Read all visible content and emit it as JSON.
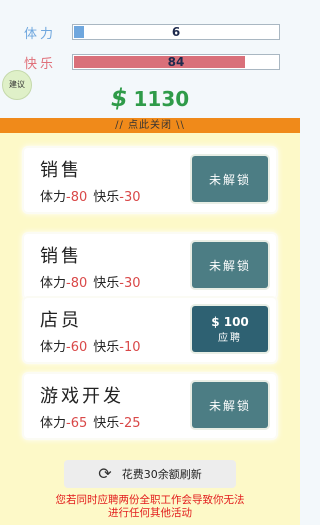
{
  "stats": {
    "stamina": {
      "label": "体力",
      "value": "6",
      "fraction": 0.06
    },
    "happiness": {
      "label": "快乐",
      "value": "84",
      "fraction": 0.84
    }
  },
  "advice_label": "建议",
  "money": {
    "symbol": "$",
    "amount": "1130"
  },
  "panel": {
    "close_label": "// 点此关闭 \\\\",
    "jobs": [
      {
        "title": "销售",
        "stamina_label": "体力",
        "stamina": "-80",
        "happy_label": "快乐",
        "happy": "-30",
        "button": "未解锁"
      },
      {
        "title": "销售",
        "stamina_label": "体力",
        "stamina": "-80",
        "happy_label": "快乐",
        "happy": "-30",
        "button": "未解锁"
      },
      {
        "title": "店员",
        "stamina_label": "体力",
        "stamina": "-60",
        "happy_label": "快乐",
        "happy": "-10",
        "price": "$ 100",
        "button": "应聘"
      },
      {
        "title": "游戏开发",
        "stamina_label": "体力",
        "stamina": "-65",
        "happy_label": "快乐",
        "happy": "-25",
        "button": "未解锁"
      }
    ],
    "refresh_label": "花费30余额刷新",
    "warning_line1": "您若同时应聘两份全职工作会导致你无法",
    "warning_line2": "进行任何其他活动"
  },
  "colors": {
    "header": "#f08a1a",
    "money": "#2f9b49",
    "button": "#4c7d84",
    "negative": "#d94848"
  },
  "icons": {
    "refresh": "refresh-icon"
  }
}
